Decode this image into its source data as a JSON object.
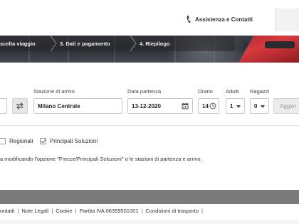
{
  "header": {
    "assist_label": "Assistenza e Contatti"
  },
  "steps": [
    {
      "label": "scelta viaggio"
    },
    {
      "label": "3. Dati e pagamento"
    },
    {
      "label": "4. Riepilogo"
    }
  ],
  "form": {
    "departure_label": "",
    "arrival_label": "Stazione di arrivo",
    "arrival_value": "Milano Centrale",
    "date_label": "Data partenza",
    "date_value": "13-12-2020",
    "time_label": "Orario",
    "time_value": "14",
    "adults_label": "Adulti",
    "adults_value": "1",
    "kids_label": "Ragazzi",
    "kids_value": "0",
    "search_label": "Aggior"
  },
  "filters": [
    {
      "label": "Regionali",
      "checked": false
    },
    {
      "label": "Principali Soluzioni",
      "checked": true
    }
  ],
  "message": "a modificando l'opzione \"Frecce/Principali Soluzioni\" o le stazioni di partenza e arrivo.",
  "footer": {
    "links": [
      "ontatti",
      "Note Legali",
      "Cookie",
      "Partita IVA 06359501001",
      "Condizioni di trasporto"
    ],
    "trailing_sep": "|"
  },
  "colors": {
    "check_green": "#3a8a1f",
    "train_red": "#c8262c",
    "footer_grey": "#7a7a7a"
  },
  "icons": [
    "phone-icon",
    "swap-arrows-icon",
    "calendar-icon",
    "clock-icon",
    "caret-down-icon",
    "check-icon"
  ]
}
